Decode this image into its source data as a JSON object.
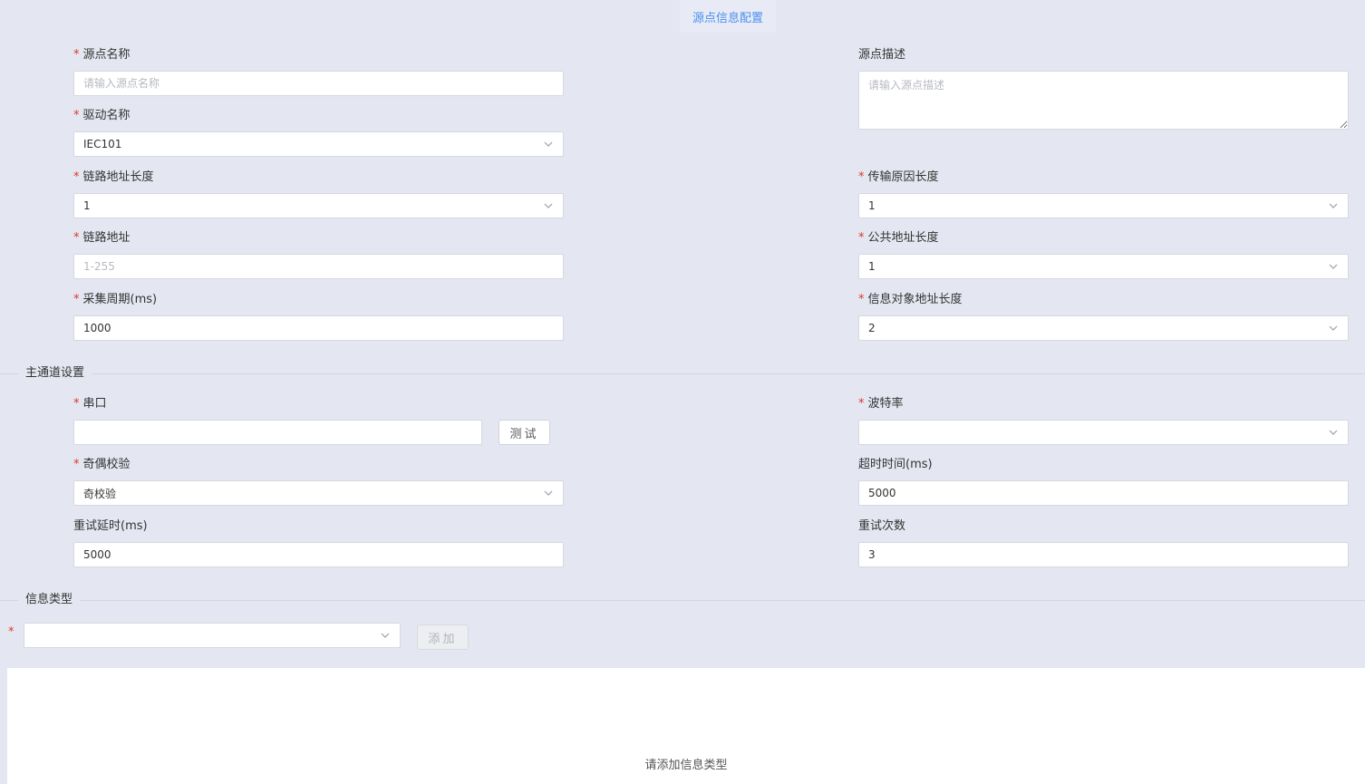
{
  "tab": {
    "label": "源点信息配置"
  },
  "basic": {
    "source_name": {
      "label": "源点名称",
      "required": true,
      "placeholder": "请输入源点名称",
      "value": ""
    },
    "source_desc": {
      "label": "源点描述",
      "required": false,
      "placeholder": "请输入源点描述",
      "value": ""
    },
    "driver_name": {
      "label": "驱动名称",
      "required": true,
      "value": "IEC101"
    },
    "link_addr_len": {
      "label": "链路地址长度",
      "required": true,
      "value": "1"
    },
    "cot_len": {
      "label": "传输原因长度",
      "required": true,
      "value": "1"
    },
    "link_addr": {
      "label": "链路地址",
      "required": true,
      "placeholder": "1-255",
      "value": ""
    },
    "common_addr_len": {
      "label": "公共地址长度",
      "required": true,
      "value": "1"
    },
    "poll_period": {
      "label": "采集周期(ms)",
      "required": true,
      "value": "1000"
    },
    "ioa_len": {
      "label": "信息对象地址长度",
      "required": true,
      "value": "2"
    }
  },
  "main_channel": {
    "title": "主通道设置",
    "serial_port": {
      "label": "串口",
      "required": true,
      "value": ""
    },
    "test_button": "测试",
    "baud_rate": {
      "label": "波特率",
      "required": true,
      "value": ""
    },
    "parity": {
      "label": "奇偶校验",
      "required": true,
      "value": "奇校验"
    },
    "timeout": {
      "label": "超时时间(ms)",
      "required": false,
      "value": "5000"
    },
    "retry_delay": {
      "label": "重试延时(ms)",
      "required": false,
      "value": "5000"
    },
    "retry_count": {
      "label": "重试次数",
      "required": false,
      "value": "3"
    }
  },
  "info_type": {
    "title": "信息类型",
    "select_value": "",
    "add_button": "添加",
    "empty_text": "请添加信息类型"
  },
  "colors": {
    "background": "#e4e7f1",
    "accent": "#4a8ff0",
    "required_star": "#e0342f"
  }
}
